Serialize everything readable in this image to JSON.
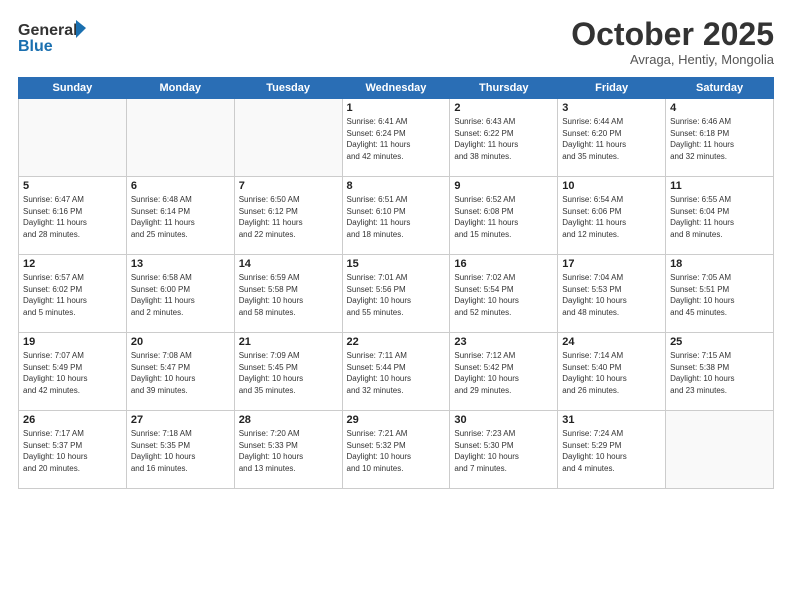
{
  "header": {
    "logo_line1": "General",
    "logo_line2": "Blue",
    "month": "October 2025",
    "location": "Avraga, Hentiy, Mongolia"
  },
  "weekdays": [
    "Sunday",
    "Monday",
    "Tuesday",
    "Wednesday",
    "Thursday",
    "Friday",
    "Saturday"
  ],
  "weeks": [
    [
      {
        "day": "",
        "info": ""
      },
      {
        "day": "",
        "info": ""
      },
      {
        "day": "",
        "info": ""
      },
      {
        "day": "1",
        "info": "Sunrise: 6:41 AM\nSunset: 6:24 PM\nDaylight: 11 hours\nand 42 minutes."
      },
      {
        "day": "2",
        "info": "Sunrise: 6:43 AM\nSunset: 6:22 PM\nDaylight: 11 hours\nand 38 minutes."
      },
      {
        "day": "3",
        "info": "Sunrise: 6:44 AM\nSunset: 6:20 PM\nDaylight: 11 hours\nand 35 minutes."
      },
      {
        "day": "4",
        "info": "Sunrise: 6:46 AM\nSunset: 6:18 PM\nDaylight: 11 hours\nand 32 minutes."
      }
    ],
    [
      {
        "day": "5",
        "info": "Sunrise: 6:47 AM\nSunset: 6:16 PM\nDaylight: 11 hours\nand 28 minutes."
      },
      {
        "day": "6",
        "info": "Sunrise: 6:48 AM\nSunset: 6:14 PM\nDaylight: 11 hours\nand 25 minutes."
      },
      {
        "day": "7",
        "info": "Sunrise: 6:50 AM\nSunset: 6:12 PM\nDaylight: 11 hours\nand 22 minutes."
      },
      {
        "day": "8",
        "info": "Sunrise: 6:51 AM\nSunset: 6:10 PM\nDaylight: 11 hours\nand 18 minutes."
      },
      {
        "day": "9",
        "info": "Sunrise: 6:52 AM\nSunset: 6:08 PM\nDaylight: 11 hours\nand 15 minutes."
      },
      {
        "day": "10",
        "info": "Sunrise: 6:54 AM\nSunset: 6:06 PM\nDaylight: 11 hours\nand 12 minutes."
      },
      {
        "day": "11",
        "info": "Sunrise: 6:55 AM\nSunset: 6:04 PM\nDaylight: 11 hours\nand 8 minutes."
      }
    ],
    [
      {
        "day": "12",
        "info": "Sunrise: 6:57 AM\nSunset: 6:02 PM\nDaylight: 11 hours\nand 5 minutes."
      },
      {
        "day": "13",
        "info": "Sunrise: 6:58 AM\nSunset: 6:00 PM\nDaylight: 11 hours\nand 2 minutes."
      },
      {
        "day": "14",
        "info": "Sunrise: 6:59 AM\nSunset: 5:58 PM\nDaylight: 10 hours\nand 58 minutes."
      },
      {
        "day": "15",
        "info": "Sunrise: 7:01 AM\nSunset: 5:56 PM\nDaylight: 10 hours\nand 55 minutes."
      },
      {
        "day": "16",
        "info": "Sunrise: 7:02 AM\nSunset: 5:54 PM\nDaylight: 10 hours\nand 52 minutes."
      },
      {
        "day": "17",
        "info": "Sunrise: 7:04 AM\nSunset: 5:53 PM\nDaylight: 10 hours\nand 48 minutes."
      },
      {
        "day": "18",
        "info": "Sunrise: 7:05 AM\nSunset: 5:51 PM\nDaylight: 10 hours\nand 45 minutes."
      }
    ],
    [
      {
        "day": "19",
        "info": "Sunrise: 7:07 AM\nSunset: 5:49 PM\nDaylight: 10 hours\nand 42 minutes."
      },
      {
        "day": "20",
        "info": "Sunrise: 7:08 AM\nSunset: 5:47 PM\nDaylight: 10 hours\nand 39 minutes."
      },
      {
        "day": "21",
        "info": "Sunrise: 7:09 AM\nSunset: 5:45 PM\nDaylight: 10 hours\nand 35 minutes."
      },
      {
        "day": "22",
        "info": "Sunrise: 7:11 AM\nSunset: 5:44 PM\nDaylight: 10 hours\nand 32 minutes."
      },
      {
        "day": "23",
        "info": "Sunrise: 7:12 AM\nSunset: 5:42 PM\nDaylight: 10 hours\nand 29 minutes."
      },
      {
        "day": "24",
        "info": "Sunrise: 7:14 AM\nSunset: 5:40 PM\nDaylight: 10 hours\nand 26 minutes."
      },
      {
        "day": "25",
        "info": "Sunrise: 7:15 AM\nSunset: 5:38 PM\nDaylight: 10 hours\nand 23 minutes."
      }
    ],
    [
      {
        "day": "26",
        "info": "Sunrise: 7:17 AM\nSunset: 5:37 PM\nDaylight: 10 hours\nand 20 minutes."
      },
      {
        "day": "27",
        "info": "Sunrise: 7:18 AM\nSunset: 5:35 PM\nDaylight: 10 hours\nand 16 minutes."
      },
      {
        "day": "28",
        "info": "Sunrise: 7:20 AM\nSunset: 5:33 PM\nDaylight: 10 hours\nand 13 minutes."
      },
      {
        "day": "29",
        "info": "Sunrise: 7:21 AM\nSunset: 5:32 PM\nDaylight: 10 hours\nand 10 minutes."
      },
      {
        "day": "30",
        "info": "Sunrise: 7:23 AM\nSunset: 5:30 PM\nDaylight: 10 hours\nand 7 minutes."
      },
      {
        "day": "31",
        "info": "Sunrise: 7:24 AM\nSunset: 5:29 PM\nDaylight: 10 hours\nand 4 minutes."
      },
      {
        "day": "",
        "info": ""
      }
    ]
  ]
}
